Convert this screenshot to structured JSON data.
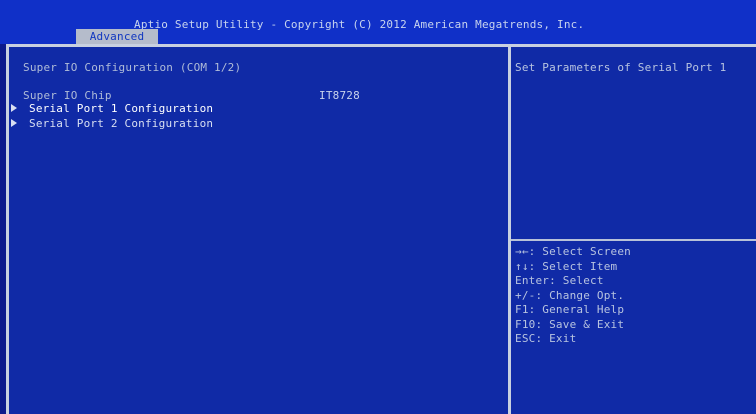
{
  "header": {
    "title": "Aptio Setup Utility - Copyright (C) 2012 American Megatrends, Inc.",
    "active_tab": "Advanced"
  },
  "main": {
    "section_title": "Super IO Configuration (COM 1/2)",
    "chip_label": "Super IO Chip",
    "chip_value": "IT8728",
    "items": [
      {
        "label": "Serial Port 1 Configuration"
      },
      {
        "label": "Serial Port 2 Configuration"
      }
    ]
  },
  "help": {
    "description": "Set Parameters of Serial Port 1",
    "keys": [
      "→←: Select Screen",
      "↑↓: Select Item",
      "Enter: Select",
      "+/-: Change Opt.",
      "F1: General Help",
      "F10: Save & Exit",
      "ESC: Exit"
    ]
  },
  "colors": {
    "background": "#0c1a8c",
    "title_bar": "#1030c8",
    "panel": "#102aa6",
    "tab": "#b5bccb",
    "text": "#b0bcd8"
  }
}
